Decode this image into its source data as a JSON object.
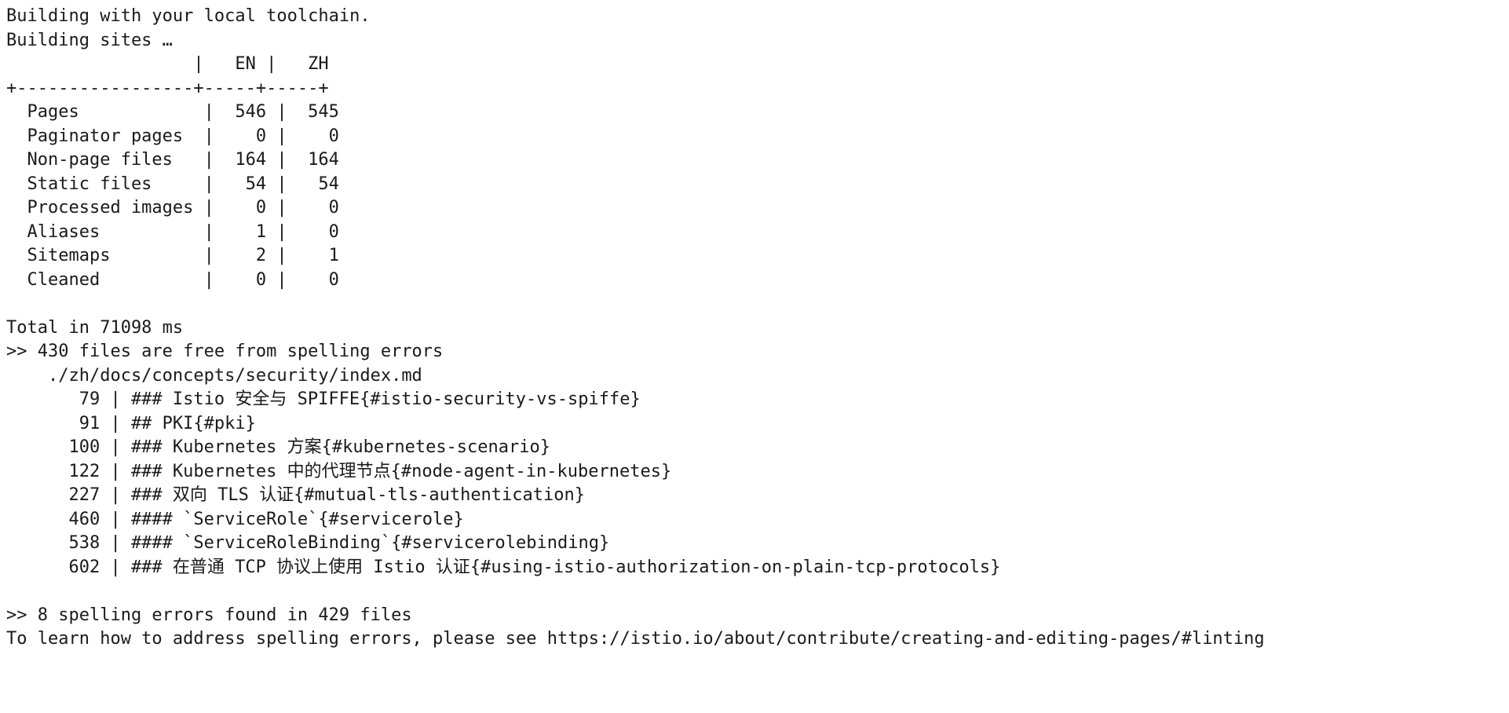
{
  "terminal": {
    "title": "Hugo build and spelling lint output",
    "foreground_color": "#1a1a1a",
    "background_color": "#ffffff",
    "lines": [
      {
        "id": "building-toolchain",
        "text": "Building with your local toolchain."
      },
      {
        "id": "building-sites",
        "text": "Building sites …"
      },
      {
        "id": "table-header",
        "text": "                  |   EN |   ZH"
      },
      {
        "id": "table-rule",
        "text": "+-----------------+-----+-----+"
      },
      {
        "id": "row-pages",
        "text": "  Pages            |  546 |  545"
      },
      {
        "id": "row-paginator-pages",
        "text": "  Paginator pages  |    0 |    0"
      },
      {
        "id": "row-non-page-files",
        "text": "  Non-page files   |  164 |  164"
      },
      {
        "id": "row-static-files",
        "text": "  Static files     |   54 |   54"
      },
      {
        "id": "row-processed-images",
        "text": "  Processed images |    0 |    0"
      },
      {
        "id": "row-aliases",
        "text": "  Aliases          |    1 |    0"
      },
      {
        "id": "row-sitemaps",
        "text": "  Sitemaps         |    2 |    1"
      },
      {
        "id": "row-cleaned",
        "text": "  Cleaned          |    0 |    0"
      },
      {
        "id": "spacer-1",
        "text": ""
      },
      {
        "id": "total-time",
        "text": "Total in 71098 ms"
      },
      {
        "id": "files-free-from-errors",
        "text": ">> 430 files are free from spelling errors"
      },
      {
        "id": "file-path",
        "text": "    ./zh/docs/concepts/security/index.md"
      },
      {
        "id": "error-line-79",
        "text": "       79 | ### Istio 安全与 SPIFFE{#istio-security-vs-spiffe}"
      },
      {
        "id": "error-line-91",
        "text": "       91 | ## PKI{#pki}"
      },
      {
        "id": "error-line-100",
        "text": "      100 | ### Kubernetes 方案{#kubernetes-scenario}"
      },
      {
        "id": "error-line-122",
        "text": "      122 | ### Kubernetes 中的代理节点{#node-agent-in-kubernetes}"
      },
      {
        "id": "error-line-227",
        "text": "      227 | ### 双向 TLS 认证{#mutual-tls-authentication}"
      },
      {
        "id": "error-line-460",
        "text": "      460 | #### `ServiceRole`{#servicerole}"
      },
      {
        "id": "error-line-538",
        "text": "      538 | #### `ServiceRoleBinding`{#servicerolebinding}"
      },
      {
        "id": "error-line-602",
        "text": "      602 | ### 在普通 TCP 协议上使用 Istio 认证{#using-istio-authorization-on-plain-tcp-protocols}"
      },
      {
        "id": "spacer-2",
        "text": ""
      },
      {
        "id": "errors-found-summary",
        "text": ">> 8 spelling errors found in 429 files"
      },
      {
        "id": "learn-more",
        "text": "To learn how to address spelling errors, please see https://istio.io/about/contribute/creating-and-editing-pages/#linting"
      }
    ],
    "table": {
      "columns": [
        "",
        "EN",
        "ZH"
      ],
      "rows": [
        {
          "label": "Pages",
          "en": "546",
          "zh": "545"
        },
        {
          "label": "Paginator pages",
          "en": "0",
          "zh": "0"
        },
        {
          "label": "Non-page files",
          "en": "164",
          "zh": "164"
        },
        {
          "label": "Static files",
          "en": "54",
          "zh": "54"
        },
        {
          "label": "Processed images",
          "en": "0",
          "zh": "0"
        },
        {
          "label": "Aliases",
          "en": "1",
          "zh": "0"
        },
        {
          "label": "Sitemaps",
          "en": "2",
          "zh": "1"
        },
        {
          "label": "Cleaned",
          "en": "0",
          "zh": "0"
        }
      ]
    },
    "summary": {
      "total_time_ms": "71098",
      "files_free_from_errors": "430",
      "spelling_errors_found": "8",
      "files_scanned": "429",
      "linting_doc_url": "https://istio.io/about/contribute/creating-and-editing-pages/#linting",
      "offending_file": "./zh/docs/concepts/security/index.md"
    },
    "spelling_errors": [
      {
        "line": "79",
        "content": "### Istio 安全与 SPIFFE{#istio-security-vs-spiffe}"
      },
      {
        "line": "91",
        "content": "## PKI{#pki}"
      },
      {
        "line": "100",
        "content": "### Kubernetes 方案{#kubernetes-scenario}"
      },
      {
        "line": "122",
        "content": "### Kubernetes 中的代理节点{#node-agent-in-kubernetes}"
      },
      {
        "line": "227",
        "content": "### 双向 TLS 认证{#mutual-tls-authentication}"
      },
      {
        "line": "460",
        "content": "#### `ServiceRole`{#servicerole}"
      },
      {
        "line": "538",
        "content": "#### `ServiceRoleBinding`{#servicerolebinding}"
      },
      {
        "line": "602",
        "content": "### 在普通 TCP 协议上使用 Istio 认证{#using-istio-authorization-on-plain-tcp-protocols}"
      }
    ]
  }
}
